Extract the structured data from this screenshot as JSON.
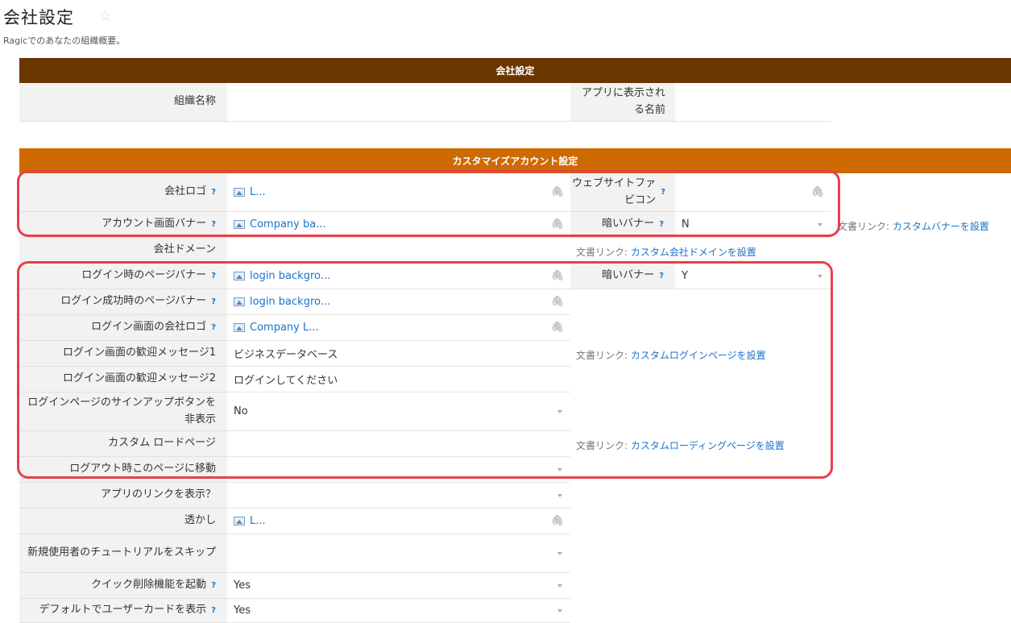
{
  "header": {
    "title": "会社設定",
    "subtitle": "Ragicでのあなたの組織概要。"
  },
  "sections": {
    "company": "会社設定",
    "custom": "カスタマイズアカウント設定"
  },
  "fields": {
    "org_name": {
      "label": "組織名称",
      "value": ""
    },
    "app_name": {
      "label": "アプリに表示される名前",
      "value": ""
    },
    "company_logo": {
      "label": "会社ロゴ",
      "value": "L..."
    },
    "favicon": {
      "label": "ウェブサイトファビコン",
      "value": ""
    },
    "account_banner": {
      "label": "アカウント画面バナー",
      "value": "Company ba..."
    },
    "dark_banner_1": {
      "label": "暗いバナー",
      "value": "N"
    },
    "domain": {
      "label": "会社ドメーン",
      "value": ""
    },
    "login_banner": {
      "label": "ログイン時のページバナー",
      "value": "login backgro..."
    },
    "dark_banner_2": {
      "label": "暗いバナー",
      "value": "Y"
    },
    "login_success_banner": {
      "label": "ログイン成功時のページバナー",
      "value": "login backgro..."
    },
    "login_logo": {
      "label": "ログイン画面の会社ロゴ",
      "value": "Company L..."
    },
    "welcome1": {
      "label": "ログイン画面の歓迎メッセージ1",
      "value": "ビジネスデータベース"
    },
    "welcome2": {
      "label": "ログイン画面の歓迎メッセージ2",
      "value": "ログインしてください"
    },
    "hide_signup": {
      "label": "ログインページのサインアップボタンを非表示",
      "value": "No"
    },
    "loading_page": {
      "label": "カスタム ロードページ",
      "value": ""
    },
    "logout_redirect": {
      "label": "ログアウト時このページに移動",
      "value": ""
    },
    "show_app_link": {
      "label": "アプリのリンクを表示？",
      "value": ""
    },
    "watermark": {
      "label": "透かし",
      "value": "L..."
    },
    "skip_tutorial": {
      "label": "新規使用者のチュートリアルをスキップ",
      "value": ""
    },
    "quick_delete": {
      "label": "クイック削除機能を起動",
      "value": "Yes"
    },
    "user_card": {
      "label": "デフォルトでユーザーカードを表示",
      "value": "Yes"
    }
  },
  "help_mark": "?",
  "doc_prefix": "文書リンク:",
  "links": {
    "custom_banner": "カスタムバナーを設置",
    "custom_domain": "カスタム会社ドメインを設置",
    "custom_login": "カスタムログインページを設置",
    "custom_loading": "カスタムローディングページを設置"
  },
  "colors": {
    "section_brown": "#6b3500",
    "section_orange": "#cd6a00",
    "link_blue": "#1a73c8",
    "highlight_red": "#e8404a"
  }
}
